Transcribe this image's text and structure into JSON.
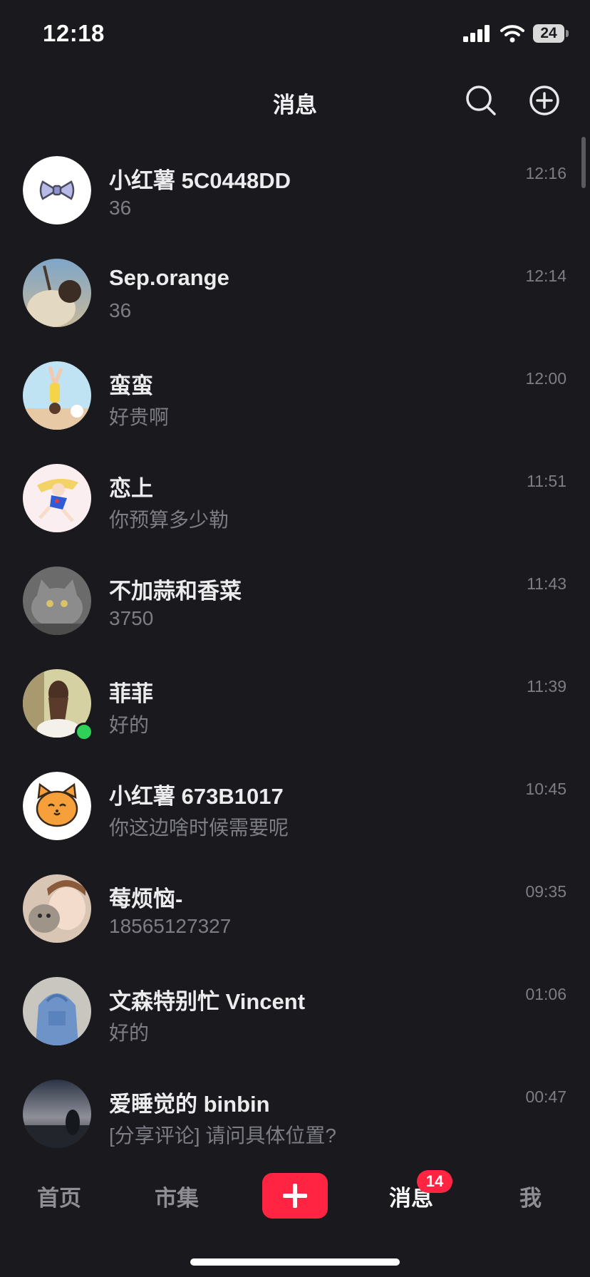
{
  "status_bar": {
    "time": "12:18",
    "battery": "24",
    "icons": [
      "signal-icon",
      "wifi-icon",
      "battery-icon"
    ]
  },
  "header": {
    "title": "消息",
    "icons": [
      "search-icon",
      "add-circle-icon"
    ]
  },
  "conversations": [
    {
      "name": "小红薯 5C0448DD",
      "preview": "36",
      "time": "12:16",
      "avatar": "bow-avatar"
    },
    {
      "name": "Sep.orange",
      "preview": "36",
      "time": "12:14",
      "avatar": "photo-avatar"
    },
    {
      "name": "蛮蛮",
      "preview": "好贵啊",
      "time": "12:00",
      "avatar": "cartoon-yoga-avatar"
    },
    {
      "name": "恋上",
      "preview": "你预算多少勒",
      "time": "11:51",
      "avatar": "anime-girl-avatar"
    },
    {
      "name": "不加蒜和香菜",
      "preview": "3750",
      "time": "11:43",
      "avatar": "cat-photo-avatar"
    },
    {
      "name": "菲菲",
      "preview": "好的",
      "time": "11:39",
      "avatar": "girl-photo-avatar",
      "online": true
    },
    {
      "name": "小红薯 673B1017",
      "preview": "你这边啥时候需要呢",
      "time": "10:45",
      "avatar": "orange-cat-avatar"
    },
    {
      "name": "莓烦恼-",
      "preview": "18565127327",
      "time": "09:35",
      "avatar": "girl-with-cat-avatar"
    },
    {
      "name": "文森特别忙 Vincent",
      "preview": "好的",
      "time": "01:06",
      "avatar": "blue-hoodie-avatar"
    },
    {
      "name": "爱睡觉的 binbin",
      "preview": "[分享评论] 请问具体位置?",
      "time": "00:47",
      "avatar": "sunset-avatar"
    }
  ],
  "tab_bar": {
    "home": "首页",
    "market": "市集",
    "messages": "消息",
    "me": "我",
    "messages_badge": "14",
    "active_tab": "messages"
  },
  "colors": {
    "background": "#19191e",
    "accent": "#ff2442",
    "online": "#2fd058",
    "muted_text": "#7d7d85"
  }
}
